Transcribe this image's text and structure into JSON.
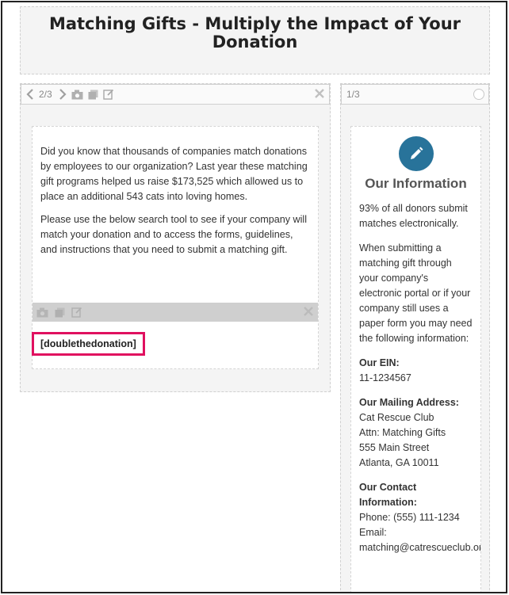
{
  "page": {
    "title": "Matching Gifts - Multiply the Impact of Your Donation"
  },
  "left_panel": {
    "toolbar": {
      "counter": "2/3"
    },
    "intro_text": "Did you know that thousands of companies match donations by employees to our organization? Last year these matching gift programs helped us raise $173,525 which allowed us to place an additional 543 cats into loving homes.",
    "search_text": "Please use the below search tool to see if your company will match your donation and to access the forms, guidelines, and instructions that you need to submit a matching gift.",
    "shortcode": "[doublethedonation]"
  },
  "right_panel": {
    "toolbar": {
      "counter": "1/3"
    },
    "heading": "Our Information",
    "stat_text": "93% of all donors submit matches electronically.",
    "portal_text": "When submitting a matching gift through your company's electronic portal or if your company still uses a paper form you may need the following information:",
    "ein_label": "Our EIN:",
    "ein_value": "11-1234567",
    "address_label": "Our Mailing Address:",
    "address_lines": [
      "Cat Rescue Club",
      "Attn: Matching Gifts",
      "555 Main Street",
      "Atlanta, GA 10011"
    ],
    "contact_label": "Our Contact Information:",
    "phone": "Phone: (555) 111-1234",
    "email_label": "Email:",
    "email": "matching@catrescueclub.org"
  },
  "colors": {
    "accent": "#28739a",
    "highlight": "#e0105f"
  },
  "icons": [
    "chevron-left-icon",
    "chevron-right-icon",
    "camera-icon",
    "copy-icon",
    "edit-icon",
    "close-icon",
    "circle-icon",
    "pencil-icon"
  ]
}
